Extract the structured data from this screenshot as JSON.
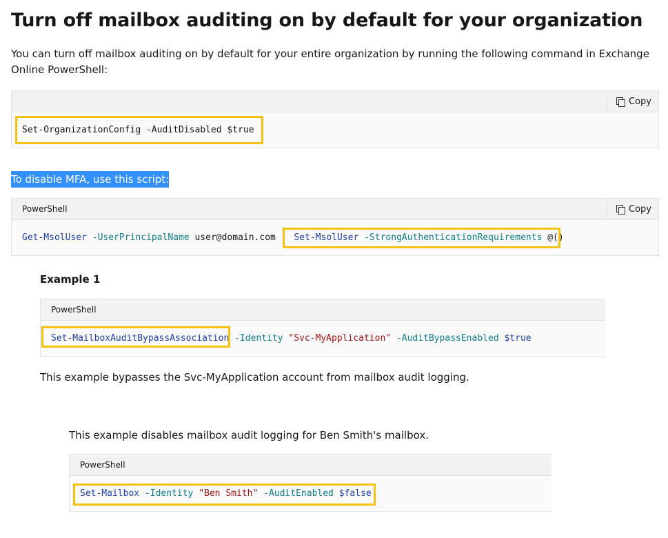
{
  "page": {
    "title": "Turn off mailbox auditing on by default for your organization",
    "intro": "You can turn off mailbox auditing on by default for your entire organization by running the following command in Exchange Online PowerShell:",
    "selected_text": "To disable MFA, use this script:"
  },
  "colors": {
    "highlight_box": "#f5c211",
    "selection": "#3390ff",
    "cmdlet": "#1f3fa6",
    "parameter": "#127c8b",
    "string": "#a31515"
  },
  "block1": {
    "copy_label": "Copy",
    "line": {
      "cmd": "Set-OrganizationConfig",
      "param": "-AuditDisabled",
      "value": "$true"
    }
  },
  "block2": {
    "lang": "PowerShell",
    "copy_label": "Copy",
    "line": {
      "cmd1": "Get-MsolUser",
      "param1": "-UserPrincipalName",
      "value1": "user@domain.com",
      "pipe": "|",
      "cmd2": "Set-MsolUser",
      "param2": "-StrongAuthenticationRequirements",
      "value2": "@()"
    }
  },
  "example1": {
    "heading": "Example 1",
    "lang": "PowerShell",
    "line": {
      "cmd": "Set-MailboxAuditBypassAssociation",
      "param1": "-Identity",
      "str": "\"Svc-MyApplication\"",
      "param2": "-AuditBypassEnabled",
      "value": "$true"
    },
    "description": "This example bypasses the Svc-MyApplication account from mailbox audit logging."
  },
  "example2": {
    "description": "This example disables mailbox audit logging for Ben Smith's mailbox.",
    "lang": "PowerShell",
    "line": {
      "cmd": "Set-Mailbox",
      "param1": "-Identity",
      "str": "\"Ben Smith\"",
      "param2": "-AuditEnabled",
      "value": "$false"
    }
  }
}
